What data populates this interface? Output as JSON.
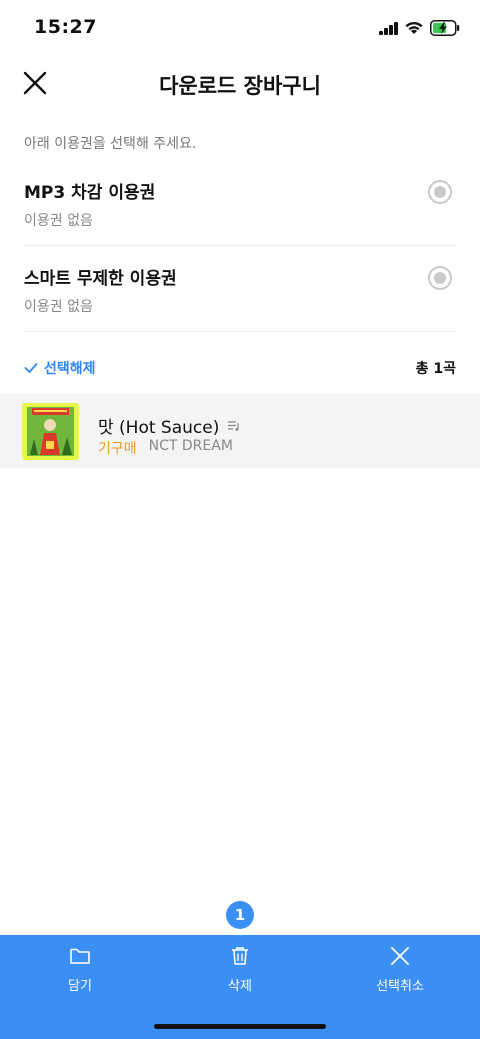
{
  "status_bar": {
    "time": "15:27"
  },
  "header": {
    "title": "다운로드 장바구니"
  },
  "instruction": "아래 이용권을 선택해 주세요.",
  "options": [
    {
      "title": "MP3 차감 이용권",
      "subtitle": "이용권 없음"
    },
    {
      "title": "스마트 무제한 이용권",
      "subtitle": "이용권 없음"
    }
  ],
  "selection": {
    "deselect_label": "선택해제",
    "count_label": "총 1곡"
  },
  "songs": [
    {
      "title": "맛 (Hot Sauce)",
      "status": "기구매",
      "artist": "NCT DREAM"
    }
  ],
  "badge_count": "1",
  "bottom_actions": [
    {
      "label": "담기",
      "icon": "folder-icon"
    },
    {
      "label": "삭제",
      "icon": "trash-icon"
    },
    {
      "label": "선택취소",
      "icon": "close-icon"
    }
  ],
  "colors": {
    "accent": "#3b8ff3",
    "purchased": "#e59b2e",
    "row_bg": "#f4f4f4"
  }
}
